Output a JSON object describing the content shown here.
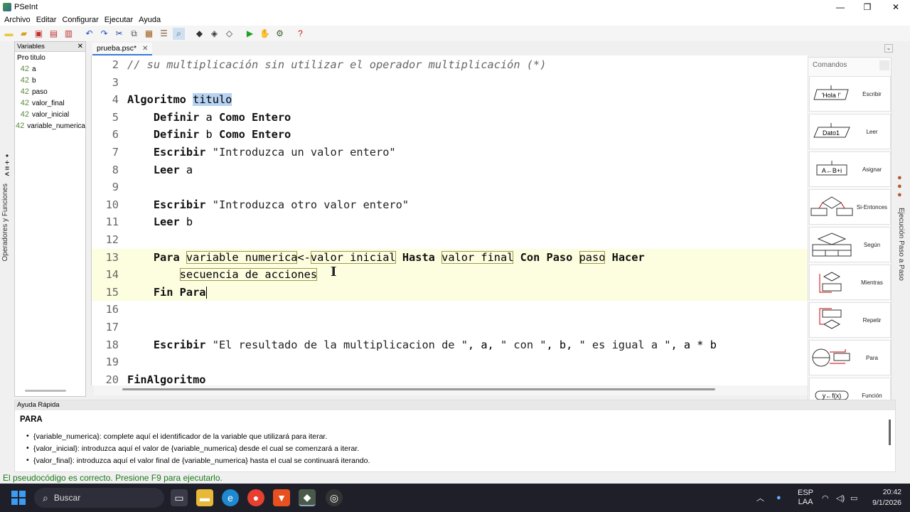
{
  "window": {
    "title": "PSeInt"
  },
  "menu": [
    "Archivo",
    "Editar",
    "Configurar",
    "Ejecutar",
    "Ayuda"
  ],
  "variables": {
    "header": "Variables",
    "root": {
      "type": "Pro",
      "name": "titulo"
    },
    "items": [
      {
        "type": "42",
        "name": "a"
      },
      {
        "type": "42",
        "name": "b"
      },
      {
        "type": "42",
        "name": "paso"
      },
      {
        "type": "42",
        "name": "valor_final"
      },
      {
        "type": "42",
        "name": "valor_inicial"
      },
      {
        "type": "42",
        "name": "variable_numerica"
      }
    ]
  },
  "left_sidebar": {
    "label": "Operadores y Funciones"
  },
  "tab": {
    "label": "prueba.psc*"
  },
  "editor": {
    "lines": [
      {
        "n": "2",
        "t": "// su multiplicación sin utilizar el operador multiplicación (*)"
      },
      {
        "n": "3",
        "t": ""
      },
      {
        "n": "4",
        "t": "Algoritmo titulo"
      },
      {
        "n": "5",
        "t": "    Definir a Como Entero"
      },
      {
        "n": "6",
        "t": "    Definir b Como Entero"
      },
      {
        "n": "7",
        "t": "    Escribir \"Introduzca un valor entero\""
      },
      {
        "n": "8",
        "t": "    Leer a"
      },
      {
        "n": "9",
        "t": ""
      },
      {
        "n": "10",
        "t": "    Escribir \"Introduzca otro valor entero\""
      },
      {
        "n": "11",
        "t": "    Leer b"
      },
      {
        "n": "12",
        "t": ""
      },
      {
        "n": "13",
        "t": "    Para variable_numerica<-valor_inicial Hasta valor_final Con Paso paso Hacer"
      },
      {
        "n": "14",
        "t": "        secuencia_de_acciones"
      },
      {
        "n": "15",
        "t": "    Fin Para"
      },
      {
        "n": "16",
        "t": ""
      },
      {
        "n": "17",
        "t": ""
      },
      {
        "n": "18",
        "t": "    Escribir \"El resultado de la multiplicacion de \", a, \" con \", b, \" es igual a \", a * b"
      },
      {
        "n": "19",
        "t": ""
      },
      {
        "n": "20",
        "t": "FinAlgoritmo"
      }
    ]
  },
  "commands": {
    "header": "Comandos",
    "items": [
      {
        "label": "Escribir",
        "icon_text": "'Hola !'"
      },
      {
        "label": "Leer",
        "icon_text": "Dato1"
      },
      {
        "label": "Asignar",
        "icon_text": "A←B+i"
      },
      {
        "label": "Si-Entonces",
        "icon_text": ""
      },
      {
        "label": "Según",
        "icon_text": ""
      },
      {
        "label": "Mientras",
        "icon_text": ""
      },
      {
        "label": "Repetir",
        "icon_text": ""
      },
      {
        "label": "Para",
        "icon_text": ""
      },
      {
        "label": "Función",
        "icon_text": "y←f(x)"
      }
    ]
  },
  "right_sidebar": {
    "label": "Ejecución Paso a Paso"
  },
  "help": {
    "header": "Ayuda Rápida",
    "title": "PARA",
    "items": [
      "{variable_numerica}: complete aquí el identificador de la variable que utilizará para iterar.",
      "{valor_inicial}: introduzca aquí el valor de {variable_numerica} desde el cual se comenzará a iterar.",
      "{valor_final}: introduzca aquí el valor final de {variable_numerica} hasta el cual se continuará iterando."
    ]
  },
  "status": "El pseudocódigo es correcto. Presione F9 para ejecutarlo.",
  "taskbar": {
    "search_placeholder": "Buscar",
    "lang": "ESP",
    "lang2": "LAA",
    "time": "20:42",
    "date": "9/1/2026"
  }
}
